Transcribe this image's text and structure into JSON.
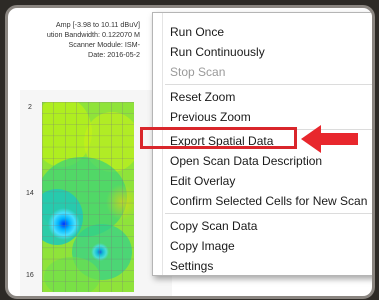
{
  "plot": {
    "header_lines": [
      "Amp [-3.98 to 10.11 dBuV]",
      "ution Bandwidth: 0.122070 M",
      "Scanner Module: ISM-",
      "Date: 2016-05-2"
    ],
    "y_ticks": [
      "2",
      "14",
      "16"
    ]
  },
  "menu": {
    "items": [
      {
        "label": "Run Once",
        "enabled": true
      },
      {
        "label": "Run Continuously",
        "enabled": true
      },
      {
        "label": "Stop Scan",
        "enabled": false
      },
      {
        "label": "Reset Zoom",
        "enabled": true
      },
      {
        "label": "Previous Zoom",
        "enabled": true
      },
      {
        "label": "Export Spatial Data",
        "enabled": true,
        "highlighted": true
      },
      {
        "label": "Open Scan Data Description",
        "enabled": true
      },
      {
        "label": "Edit Overlay",
        "enabled": true
      },
      {
        "label": "Confirm Selected Cells for New Scan",
        "enabled": true
      },
      {
        "label": "Copy Scan Data",
        "enabled": true
      },
      {
        "label": "Copy Image",
        "enabled": true
      },
      {
        "label": "Settings",
        "enabled": true
      }
    ]
  },
  "colors": {
    "highlight_border": "#d9262b",
    "arrow": "#e8272d"
  }
}
